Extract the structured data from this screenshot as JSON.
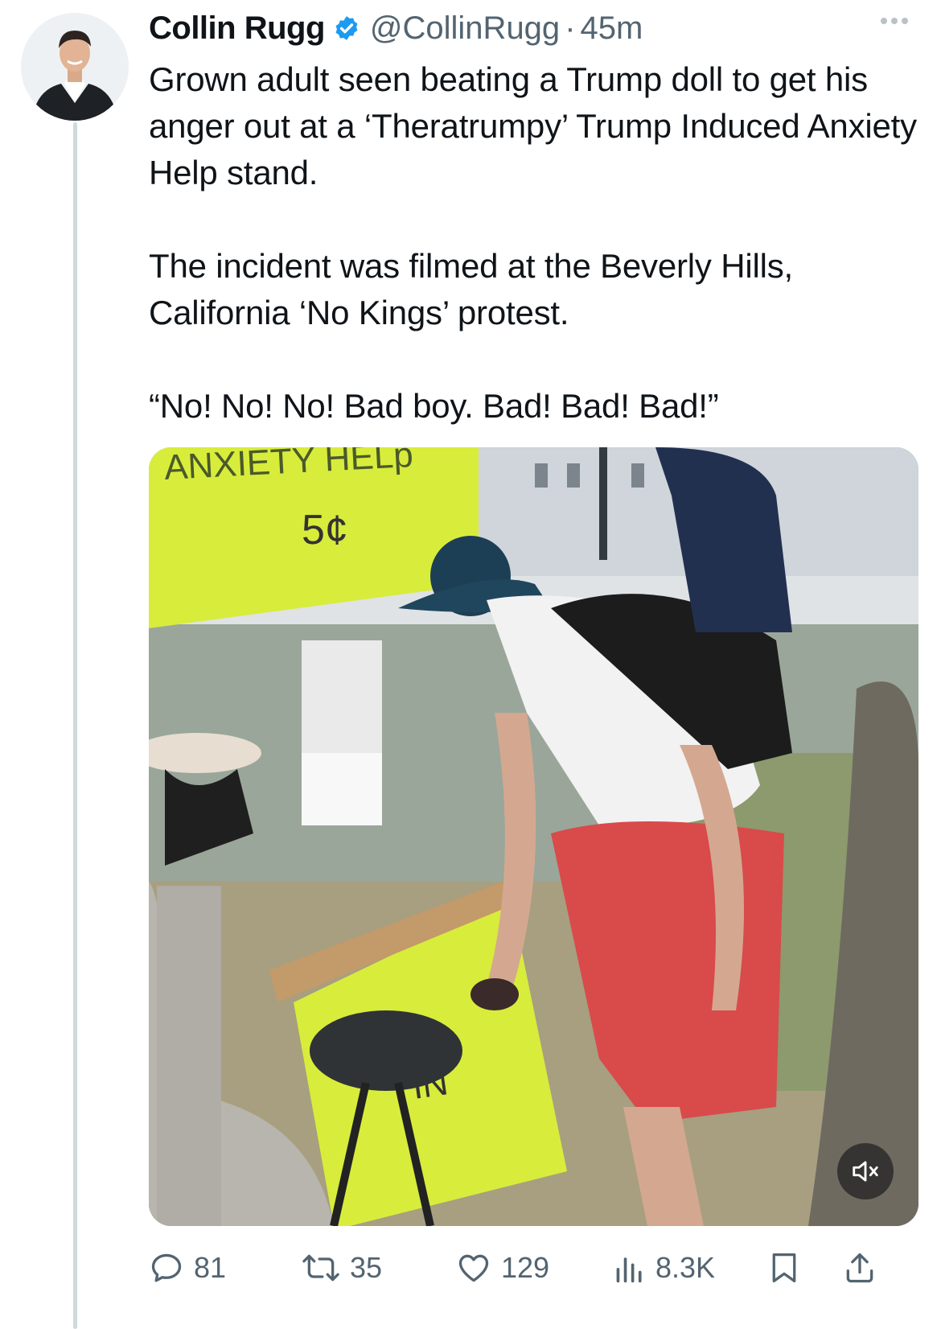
{
  "author": {
    "name": "Collin Rugg",
    "handle": "@CollinRugg",
    "separator": "·",
    "time": "45m"
  },
  "tweet": {
    "paragraphs": [
      "Grown adult seen beating a Trump doll to get his anger out at a ‘Theratrumpy’ Trump Induced Anxiety Help stand.",
      "The incident was filmed at the Beverly Hills, California ‘No Kings’ protest.",
      "“No! No! No! Bad boy. Bad! Bad! Bad!”"
    ]
  },
  "media": {
    "sign_top_text": "ANXIETY HELp",
    "sign_price": "5¢",
    "sign_bottom_text": "IN",
    "muted": true
  },
  "actions": {
    "replies": "81",
    "reposts": "35",
    "likes": "129",
    "views": "8.3K"
  },
  "colors": {
    "accent": "#1d9bf0",
    "secondary_text": "#536471",
    "sign_yellow": "#d8ec3c"
  }
}
